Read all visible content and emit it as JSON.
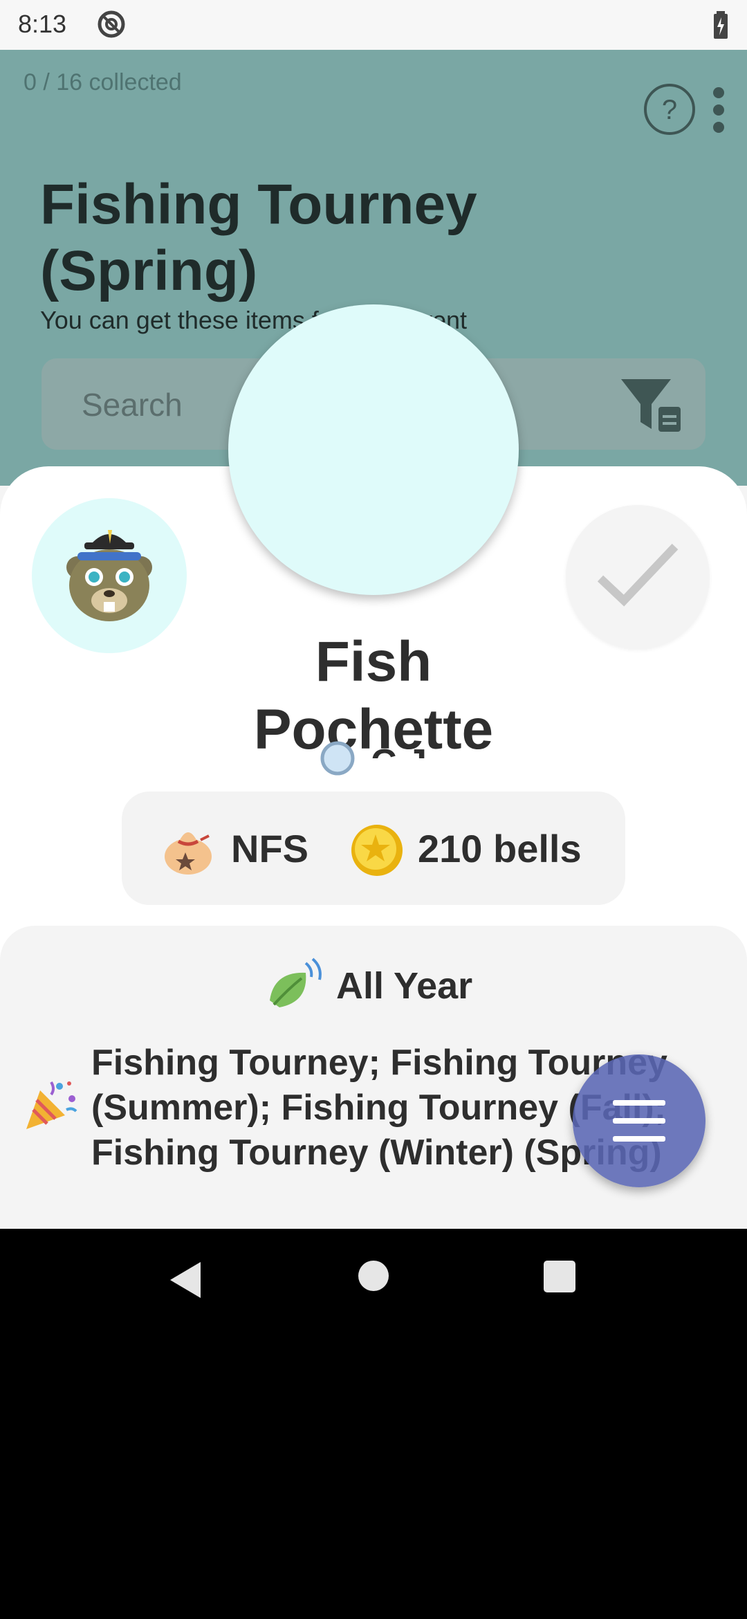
{
  "status_bar": {
    "time": "8:13"
  },
  "header": {
    "collected": "0 / 16 collected",
    "title": "Fishing Tourney (Spring)",
    "subtitle": "You can get these items f",
    "subtitle_tail": "vent"
  },
  "search": {
    "placeholder": "Search"
  },
  "item": {
    "name": "Fish Pochette",
    "purchase": "NFS",
    "sell_price": "210 bells",
    "season": "All Year",
    "events": "Fishing Tourney; Fishing Tourney (Summer); Fishing Tourney (Fall); Fishing Tourney (Winter) (Spring)",
    "source_partial": "C.J."
  },
  "colors": {
    "header_bg": "#7aa7a4",
    "preview_circle": "#dffbfa",
    "fab": "#5a67b4"
  },
  "icons": {
    "villager": "cj-villager-icon",
    "check": "check-icon",
    "nfs": "bag-icon",
    "coin": "bell-coin-icon",
    "season": "leaf-icon",
    "event": "party-popper-icon",
    "menu": "menu-icon"
  }
}
